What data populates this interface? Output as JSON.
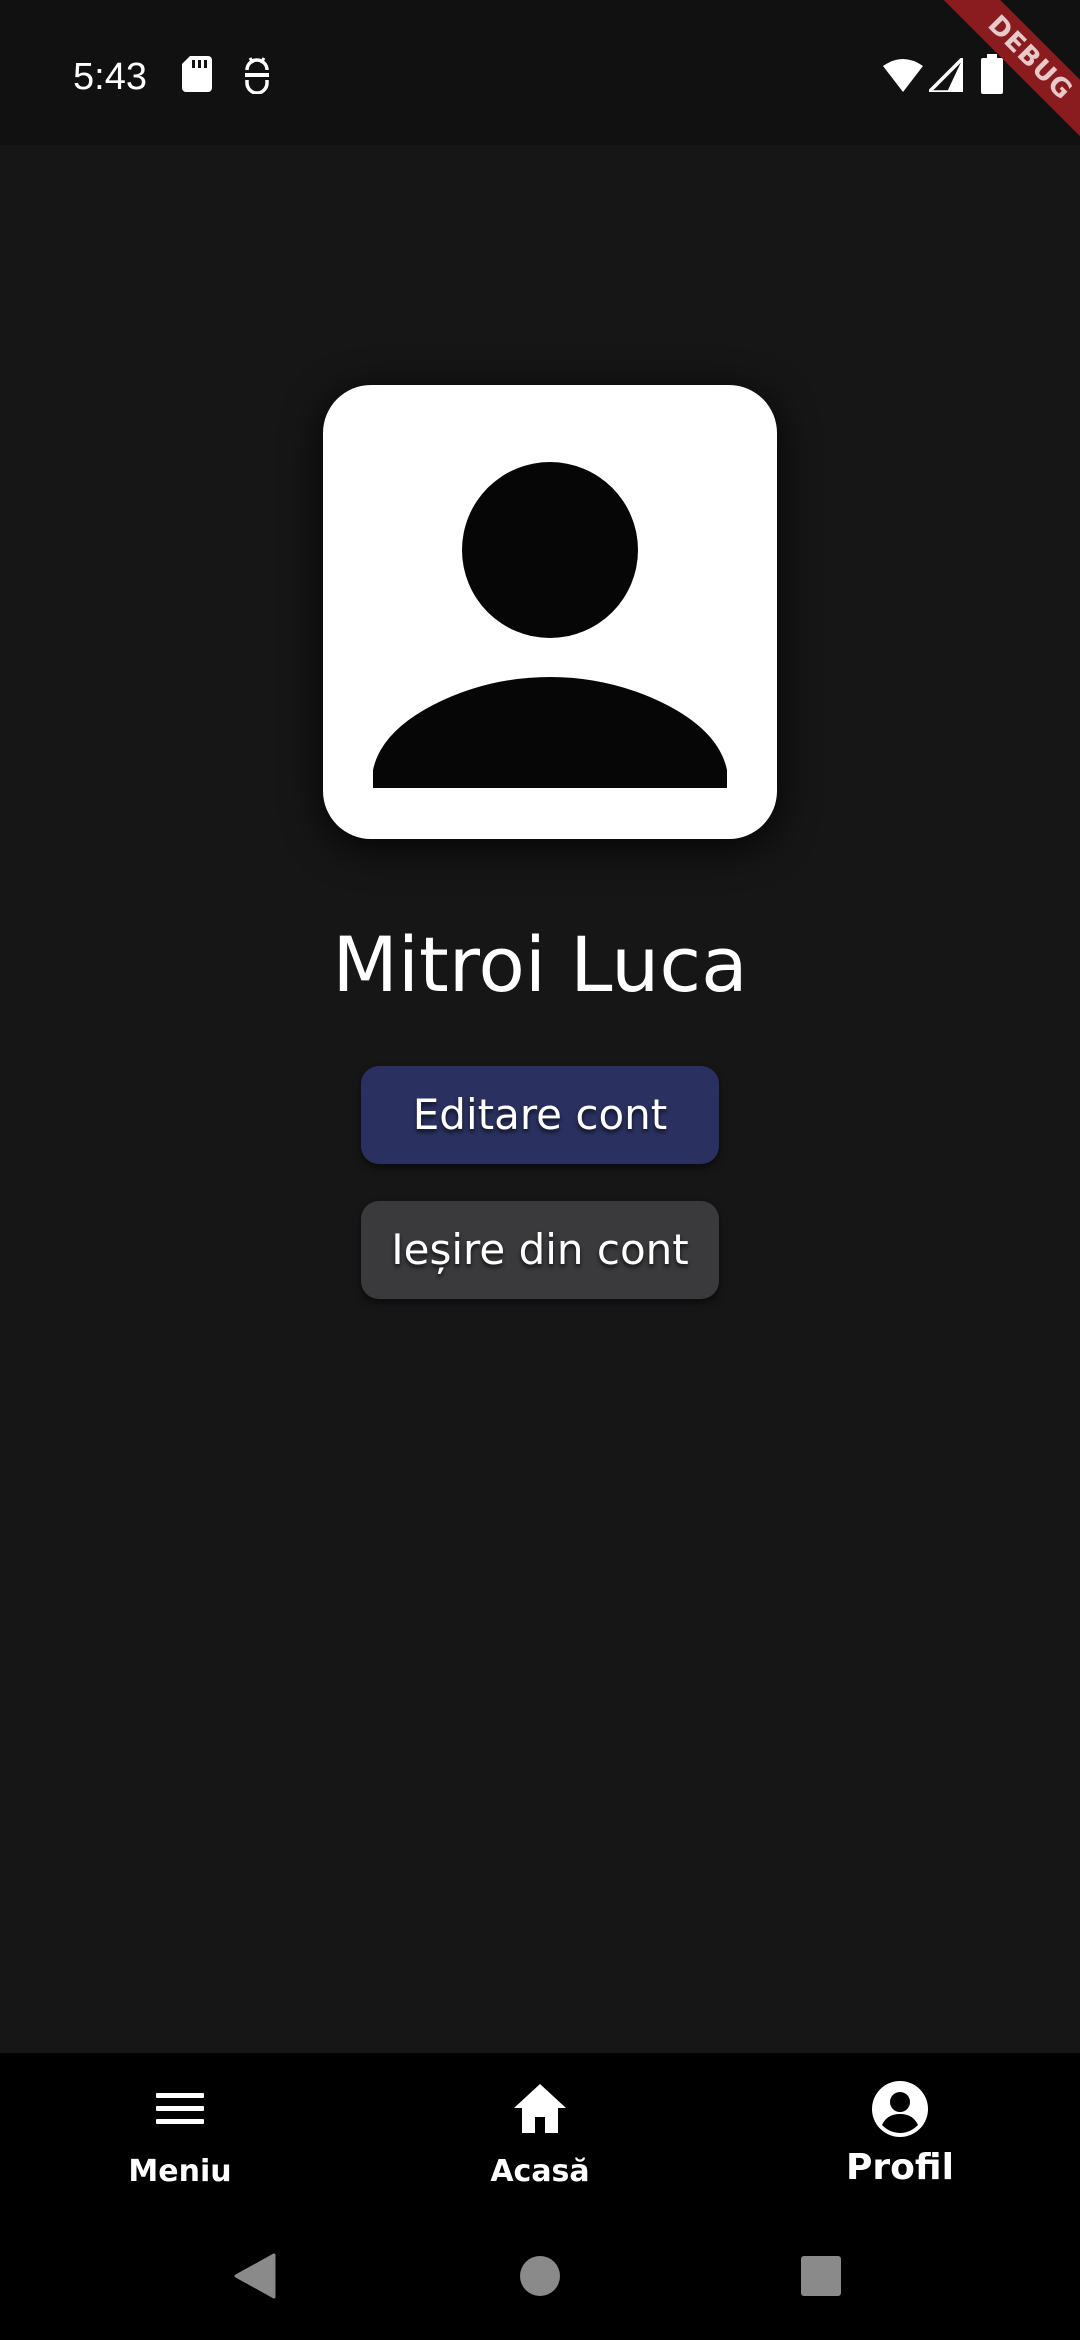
{
  "status_bar": {
    "time": "5:43",
    "icons": [
      "sd-card-icon",
      "android-debug-icon",
      "wifi-icon",
      "cell-signal-icon",
      "battery-icon"
    ],
    "debug_banner": "DEBUG"
  },
  "profile": {
    "name": "Mitroi Luca",
    "avatar_icon": "person-icon"
  },
  "actions": {
    "edit_label": "Editare cont",
    "logout_label": "Ieșire din cont"
  },
  "bottom_nav": {
    "items": [
      {
        "label": "Meniu",
        "icon": "menu-icon"
      },
      {
        "label": "Acasă",
        "icon": "home-icon"
      },
      {
        "label": "Profil",
        "icon": "account-circle-icon",
        "active": true
      }
    ]
  },
  "system_nav": {
    "icons": [
      "back-icon",
      "home-circle-icon",
      "recents-icon"
    ]
  },
  "colors": {
    "background": "#161617",
    "edit_button": "#2a3160",
    "logout_button": "#3a3a3c",
    "debug_ribbon": "#8a1b1f"
  }
}
